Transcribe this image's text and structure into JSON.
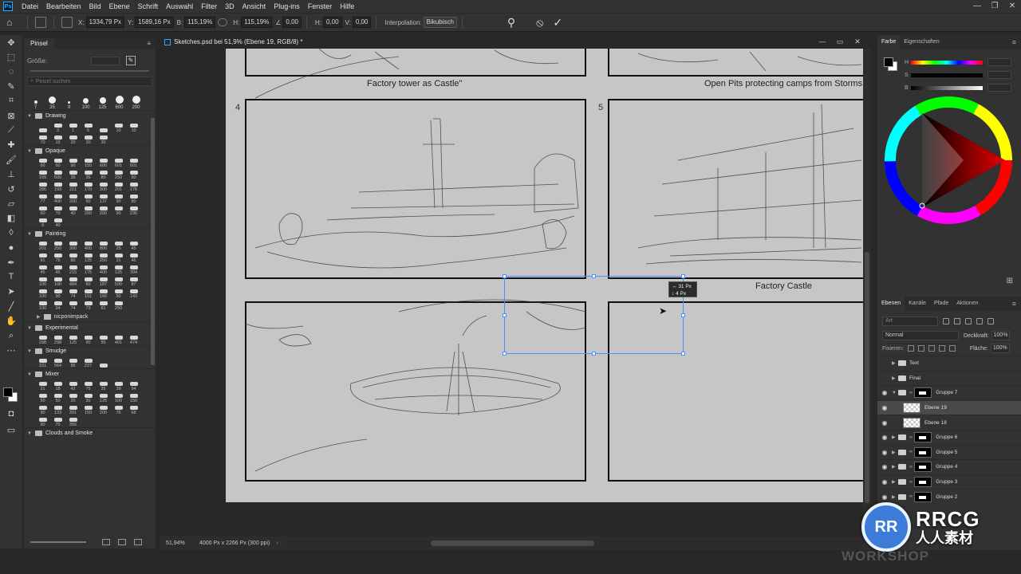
{
  "menubar": {
    "items": [
      "Datei",
      "Bearbeiten",
      "Bild",
      "Ebene",
      "Schrift",
      "Auswahl",
      "Filter",
      "3D",
      "Ansicht",
      "Plug-ins",
      "Fenster",
      "Hilfe"
    ],
    "window_controls": [
      "—",
      "❐",
      "✕"
    ]
  },
  "options": {
    "x_label": "X:",
    "x_value": "1334,79 Px",
    "y_label": "Y:",
    "y_value": "1589,16 Px",
    "w_label": "B:",
    "w_value": "115,19%",
    "h_label": "H:",
    "h_value": "115,19%",
    "angle_value": "0,00",
    "hskew_label": "H:",
    "hskew_value": "0,00",
    "vskew_label": "V:",
    "vskew_value": "0,00",
    "interp_label": "Interpolation:",
    "interp_value": "Bikubisch",
    "cancel_icon": "⦸",
    "commit_icon": "✓"
  },
  "tools": [
    "move",
    "marquee",
    "lasso",
    "quick-select",
    "crop",
    "frame",
    "eyedropper",
    "healing",
    "brush",
    "stamp",
    "history-brush",
    "eraser",
    "gradient",
    "blur",
    "dodge",
    "pen",
    "type",
    "path-select",
    "rectangle",
    "hand",
    "zoom",
    "more"
  ],
  "brush_panel": {
    "tab_label": "Pinsel",
    "size_label": "Größe:",
    "search_placeholder": "Pinsel suchen",
    "recent": [
      "7",
      "35",
      "9",
      "100",
      "125",
      "600",
      "200"
    ],
    "groups": [
      {
        "name": "Drawing",
        "values": [
          "",
          "3",
          "1",
          "5",
          "",
          "10",
          "10",
          "70",
          "15",
          "20",
          "20",
          "30"
        ]
      },
      {
        "name": "Opaque",
        "values": [
          "60",
          "60",
          "90",
          "150",
          "600",
          "601",
          "601",
          "155",
          "500",
          "35",
          "35",
          "80",
          "250",
          "90",
          "286",
          "193",
          "211",
          "170",
          "300",
          "201",
          "176",
          "77",
          "400",
          "200",
          "90",
          "137",
          "90",
          "80",
          "60",
          "70",
          "40",
          "200",
          "200",
          "90",
          "236",
          "9",
          "40"
        ]
      },
      {
        "name": "Painting",
        "values": [
          "201",
          "250",
          "300",
          "400",
          "800",
          "25",
          "45",
          "91",
          "75",
          "80",
          "125",
          "250",
          "31",
          "45",
          "45",
          "45",
          "215",
          "175",
          "400",
          "125",
          "394",
          "100",
          "100",
          "484",
          "80",
          "187",
          "500",
          "87",
          "100",
          "90",
          "74",
          "101",
          "166",
          "50",
          "143",
          "100",
          "94",
          "74",
          "73",
          "81",
          "250"
        ]
      },
      {
        "name": "Experimental",
        "values": [
          "298",
          "298",
          "125",
          "90",
          "95",
          "401",
          "474"
        ]
      },
      {
        "name": "Smudge",
        "values": [
          "151",
          "564",
          "95",
          "227",
          ""
        ]
      },
      {
        "name": "Mixer",
        "values": [
          "21",
          "18",
          "42",
          "75",
          "35",
          "39",
          "94",
          "50",
          "50",
          "20",
          "30",
          "125",
          "100",
          "150",
          "90",
          "133",
          "391",
          "150",
          "200",
          "76",
          "68",
          "90",
          "70",
          "356"
        ]
      },
      {
        "name": "Clouds and Smoke",
        "values": []
      }
    ],
    "subfolder": "nicponimpack"
  },
  "document": {
    "tab_title": "Sketches.psd bei 51,9% (Ebene 19, RGB/8) *",
    "zoom": "51,94%",
    "docinfo": "4000 Px x 2266 Px (300 ppi)",
    "captions": {
      "top_left": "Factory tower as Castle\"",
      "top_right": "Open Pits protecting camps from Storms",
      "mid_right": "Factory Castle"
    },
    "panel_numbers": {
      "left": "4",
      "right": "5"
    },
    "transform_tooltip": {
      "line1": "31 Px",
      "line2": "4 Px"
    }
  },
  "color_panel": {
    "tabs": [
      "Farbe",
      "Eigenschaften"
    ],
    "labels": [
      "H",
      "S",
      "B"
    ],
    "accent": "#ff0000"
  },
  "layers_panel": {
    "tabs": [
      "Ebenen",
      "Kanäle",
      "Pfade",
      "Aktionen"
    ],
    "filter_label": "Art",
    "blend_mode": "Normal",
    "opacity_label": "Deckkraft:",
    "opacity_value": "100%",
    "lock_label": "Fixieren:",
    "fill_label": "Fläche:",
    "fill_value": "100%",
    "layers": [
      {
        "name": "Text",
        "type": "group",
        "visible": false
      },
      {
        "name": "Final",
        "type": "group",
        "visible": false
      },
      {
        "name": "Gruppe 7",
        "type": "group-mask",
        "visible": true
      },
      {
        "name": "Ebene 19",
        "type": "layer",
        "visible": true,
        "selected": true
      },
      {
        "name": "Ebene 18",
        "type": "layer",
        "visible": true
      },
      {
        "name": "Gruppe 6",
        "type": "group-mask",
        "visible": true
      },
      {
        "name": "Gruppe 5",
        "type": "group-mask",
        "visible": true
      },
      {
        "name": "Gruppe 4",
        "type": "group-mask",
        "visible": true
      },
      {
        "name": "Gruppe 3",
        "type": "group-mask",
        "visible": true
      },
      {
        "name": "Gruppe 2",
        "type": "group-mask",
        "visible": true
      }
    ]
  },
  "watermark": {
    "logo_text": "RR",
    "brand": "RRCG",
    "subtitle": "人人素材",
    "workshop": "WORKSHOP"
  }
}
